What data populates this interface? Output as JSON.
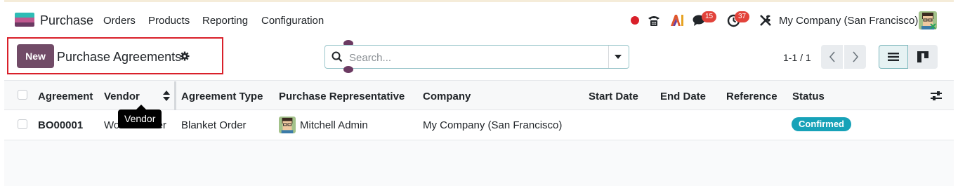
{
  "navbar": {
    "app_name": "Purchase",
    "menu": [
      "Orders",
      "Products",
      "Reporting",
      "Configuration"
    ],
    "messages_count": "15",
    "activities_count": "37",
    "company": "My Company (San Francisco)"
  },
  "control_panel": {
    "new_label": "New",
    "title": "Purchase Agreements",
    "search_placeholder": "Search...",
    "pager": "1-1 / 1"
  },
  "table": {
    "columns": [
      "Agreement",
      "Vendor",
      "Agreement Type",
      "Purchase Representative",
      "Company",
      "Start Date",
      "End Date",
      "Reference",
      "Status"
    ],
    "rows": [
      {
        "agreement": "BO00001",
        "vendor": "Wood Corner",
        "agreement_type": "Blanket Order",
        "representative": "Mitchell Admin",
        "company": "My Company (San Francisco)",
        "start_date": "",
        "end_date": "",
        "reference": "",
        "status": "Confirmed"
      }
    ]
  },
  "tooltip": "Vendor",
  "colors": {
    "brand": "#714b67",
    "status_confirmed": "#17a2b8",
    "highlight": "#d9202a",
    "badge": "#e2433b"
  }
}
